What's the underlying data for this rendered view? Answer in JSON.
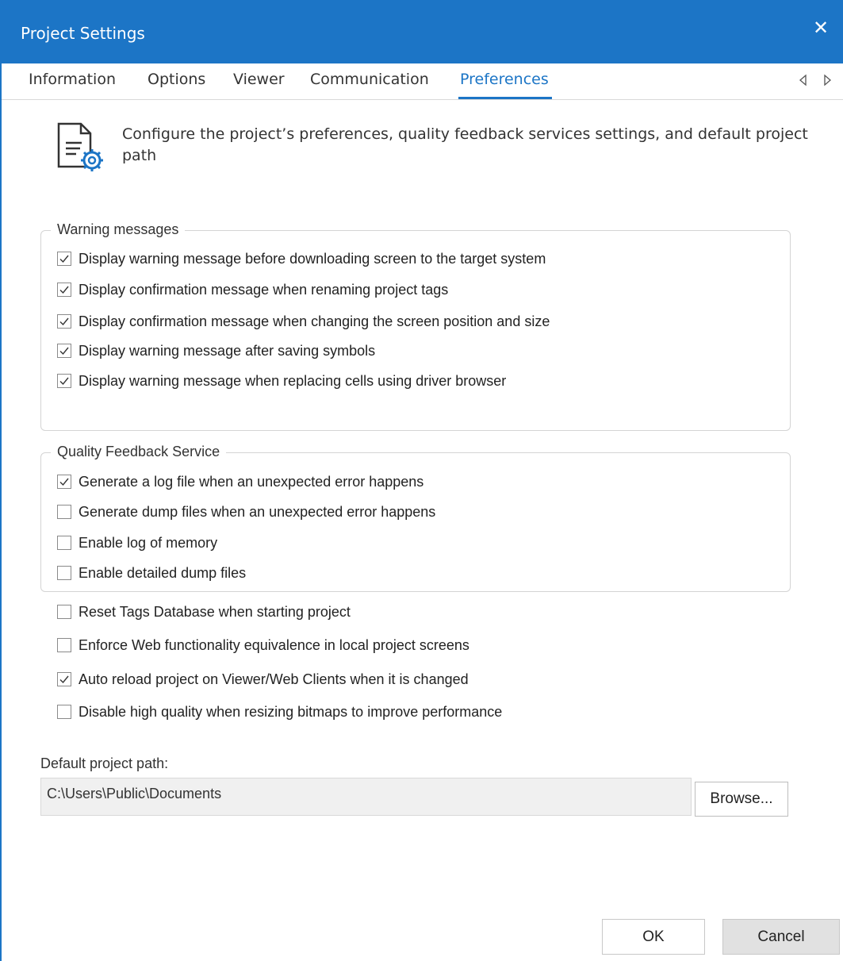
{
  "window": {
    "title": "Project Settings"
  },
  "tabs": [
    {
      "label": "Information"
    },
    {
      "label": "Options"
    },
    {
      "label": "Viewer"
    },
    {
      "label": "Communication"
    },
    {
      "label": "Preferences",
      "active": true
    }
  ],
  "header": {
    "description": "Configure the project’s preferences, quality feedback services settings, and default project path",
    "icon": "document-settings-icon"
  },
  "warning_group": {
    "legend": "Warning messages",
    "items": [
      {
        "label": "Display warning message before downloading screen to the target system",
        "checked": true
      },
      {
        "label": "Display confirmation message when renaming project tags",
        "checked": true
      },
      {
        "label": "Display confirmation message when changing the screen position and size",
        "checked": true
      },
      {
        "label": "Display warning message after saving symbols",
        "checked": true
      },
      {
        "label": "Display warning message when replacing cells using driver browser",
        "checked": true
      }
    ]
  },
  "quality_group": {
    "legend": "Quality Feedback Service",
    "items": [
      {
        "label": "Generate a log file when an unexpected error happens",
        "checked": true
      },
      {
        "label": "Generate dump files when an unexpected error happens",
        "checked": false
      },
      {
        "label": "Enable log of memory",
        "checked": false
      },
      {
        "label": "Enable detailed dump files",
        "checked": false
      }
    ]
  },
  "general_options": [
    {
      "label": "Reset Tags Database when starting project",
      "checked": false
    },
    {
      "label": "Enforce Web functionality equivalence in local project screens",
      "checked": false
    },
    {
      "label": "Auto reload project on Viewer/Web Clients when it is changed",
      "checked": true
    },
    {
      "label": "Disable high quality when resizing bitmaps to improve performance",
      "checked": false
    }
  ],
  "project_path": {
    "label": "Default project path:",
    "value": "C:\\Users\\Public\\Documents",
    "browse_label": "Browse..."
  },
  "buttons": {
    "ok": "OK",
    "cancel": "Cancel"
  },
  "colors": {
    "accent": "#1c75c6",
    "title_text": "#ffffff"
  }
}
